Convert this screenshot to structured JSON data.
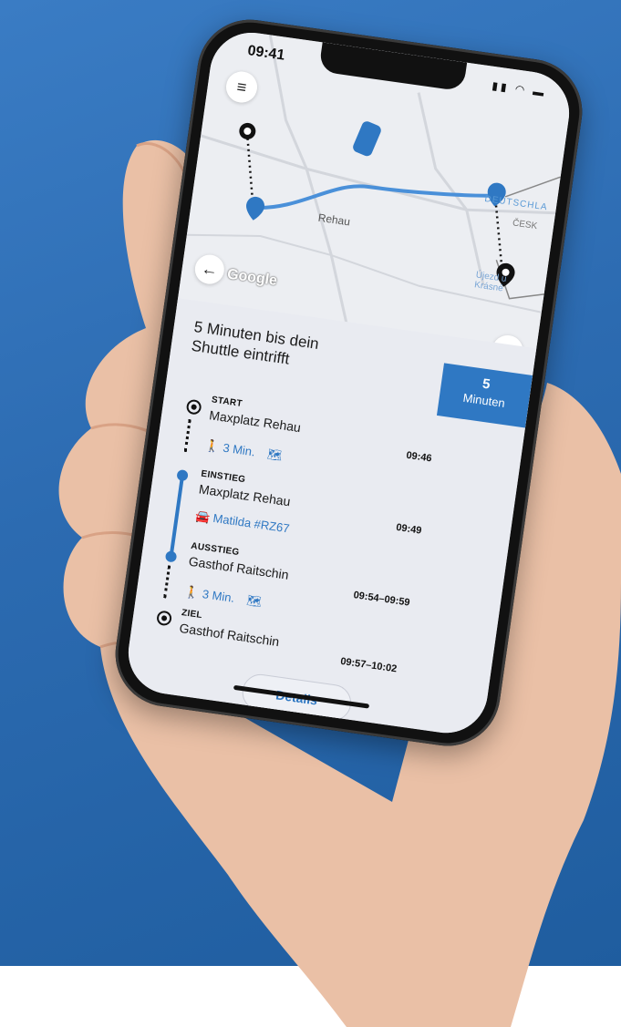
{
  "colors": {
    "accent": "#2f78c3",
    "background": "#2c6bb1",
    "panel": "#e9ebf1"
  },
  "status": {
    "time": "09:41",
    "icons": "signal-wifi-battery"
  },
  "map": {
    "google_label": "Google",
    "place_rehau": "Rehau",
    "place_deutschland": "DEUTSCHLA",
    "place_cesko": "ČESK",
    "place_ujezd": "Újezd u\nKrásné",
    "icons": [
      "menu-icon",
      "back-arrow-icon",
      "navigation-arrow-icon",
      "shuttle-car-icon"
    ]
  },
  "panel": {
    "headline": "5 Minuten bis dein Shuttle eintrifft",
    "eta_value": "5",
    "eta_unit": "Minuten",
    "steps": [
      {
        "label": "START",
        "place": "Maxplatz Rehau",
        "time": "09:46"
      },
      {
        "walk": "3 Min."
      },
      {
        "label": "EINSTIEG",
        "place": "Maxplatz Rehau",
        "time": "09:49"
      },
      {
        "vehicle": "Matilda #RZ67"
      },
      {
        "label": "AUSSTIEG",
        "place": "Gasthof Raitschin",
        "time": "09:54–09:59"
      },
      {
        "walk": "3 Min."
      },
      {
        "label": "ZIEL",
        "place": "Gasthof Raitschin",
        "time": "09:57–10:02"
      }
    ],
    "details_label": "Details"
  }
}
